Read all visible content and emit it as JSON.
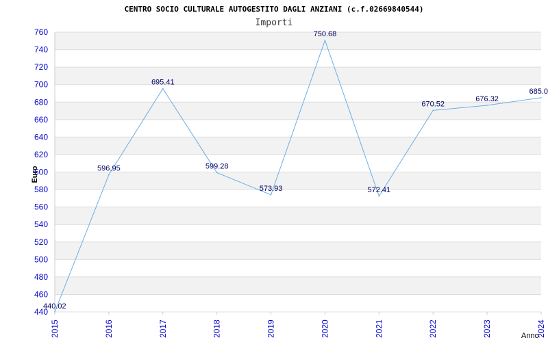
{
  "chart_data": {
    "type": "line",
    "title": "CENTRO SOCIO CULTURALE AUTOGESTITO DAGLI ANZIANI (c.f.02669840544)",
    "subtitle": "Importi",
    "xlabel": "Anno",
    "ylabel": "Euro",
    "ylim": [
      440,
      760
    ],
    "ytick_step": 20,
    "grid": true,
    "categories": [
      "2015",
      "2016",
      "2017",
      "2018",
      "2019",
      "2020",
      "2021",
      "2022",
      "2023",
      "2024"
    ],
    "values": [
      440.02,
      596.95,
      695.41,
      599.28,
      573.93,
      750.68,
      572.41,
      670.52,
      676.32,
      685.0
    ],
    "data_labels": [
      "440.02",
      "596.95",
      "695.41",
      "599.28",
      "573.93",
      "750.68",
      "572.41",
      "670.52",
      "676.32",
      "685.0"
    ],
    "colors": {
      "line": "#6aaee8",
      "band": "#f2f2f2",
      "tick": "#0000cc",
      "label": "#000066"
    }
  }
}
